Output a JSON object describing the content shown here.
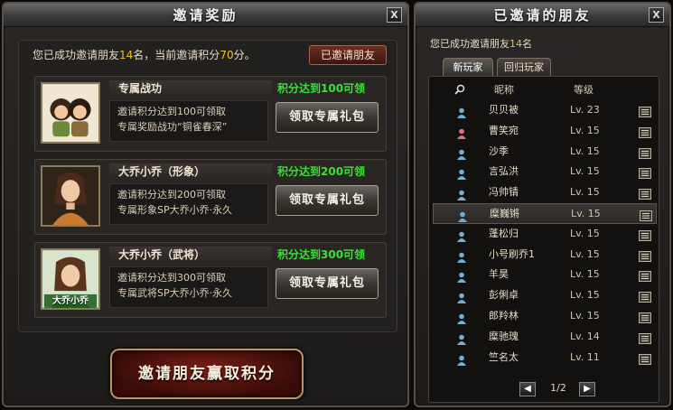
{
  "left_panel": {
    "title": "邀请奖励",
    "close_label": "X",
    "summary": {
      "prefix": "您已成功邀请朋友",
      "invited_count": "14",
      "middle": "名，当前邀请积分",
      "points": "70",
      "suffix": "分。"
    },
    "invited_friends_button": "已邀请朋友",
    "rewards": [
      {
        "name": "专属战功",
        "requirement": "积分达到100可领",
        "desc_line1": "邀请积分达到100可领取",
        "desc_line2": "专属奖励战功“铜雀春深”",
        "button": "领取专属礼包"
      },
      {
        "name": "大乔小乔（形象）",
        "requirement": "积分达到200可领",
        "desc_line1": "邀请积分达到200可领取",
        "desc_line2": "专属形象SP大乔小乔·永久",
        "button": "领取专属礼包"
      },
      {
        "name": "大乔小乔（武将）",
        "requirement": "积分达到300可领",
        "desc_line1": "邀请积分达到300可领取",
        "desc_line2": "专属武将SP大乔小乔·永久",
        "button": "领取专属礼包",
        "portrait_tag": "大乔小乔"
      }
    ],
    "main_action_button": "邀请朋友赢取积分"
  },
  "right_panel": {
    "title": "已邀请的朋友",
    "close_label": "X",
    "summary": {
      "prefix": "您已成功邀请朋友",
      "count": "14",
      "suffix": "名"
    },
    "tabs": [
      {
        "label": "新玩家"
      },
      {
        "label": "回归玩家"
      }
    ],
    "header": {
      "name": "昵称",
      "level": "等级"
    },
    "friends": [
      {
        "name": "贝贝被",
        "level": "Lv. 23",
        "gender": "male"
      },
      {
        "name": "曹笑宛",
        "level": "Lv. 15",
        "gender": "female"
      },
      {
        "name": "沙季",
        "level": "Lv. 15",
        "gender": "male"
      },
      {
        "name": "言弘洪",
        "level": "Lv. 15",
        "gender": "male"
      },
      {
        "name": "冯帅锖",
        "level": "Lv. 15",
        "gender": "male"
      },
      {
        "name": "糜巍锵",
        "level": "Lv. 15",
        "gender": "male",
        "selected": true
      },
      {
        "name": "蓬松归",
        "level": "Lv. 15",
        "gender": "male"
      },
      {
        "name": "小号刷乔1",
        "level": "Lv. 15",
        "gender": "male"
      },
      {
        "name": "羊昊",
        "level": "Lv. 15",
        "gender": "male"
      },
      {
        "name": "彭俐卓",
        "level": "Lv. 15",
        "gender": "male"
      },
      {
        "name": "郎羚林",
        "level": "Lv. 15",
        "gender": "male"
      },
      {
        "name": "糜驰瑰",
        "level": "Lv. 14",
        "gender": "male"
      },
      {
        "name": "竺名太",
        "level": "Lv. 11",
        "gender": "male"
      }
    ],
    "pager": {
      "label": "1/2",
      "prev": "◀",
      "next": "▶"
    }
  },
  "colors": {
    "highlight": "#f0c020",
    "requirement": "#38e238",
    "male_icon": "#6fb0d8",
    "female_icon": "#e46a8a"
  }
}
